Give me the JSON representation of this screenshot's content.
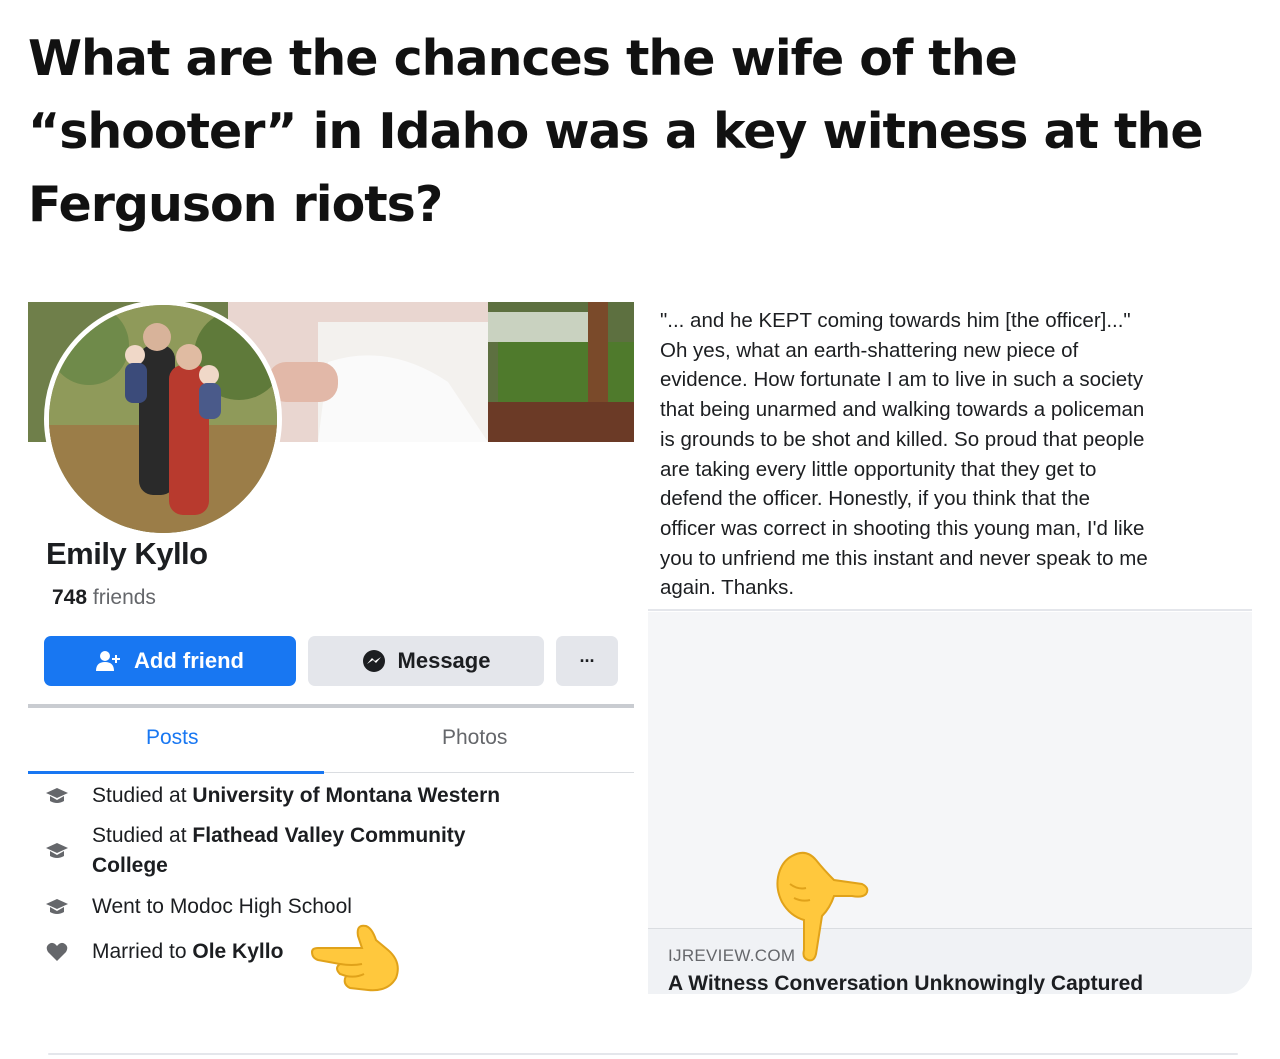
{
  "headline": "What are the chances the wife of the “shooter” in Idaho was a key witness at the Ferguson riots?",
  "profile": {
    "name": "Emily Kyllo",
    "friends_count": "748",
    "friends_label": "friends",
    "add_friend_label": "Add friend",
    "message_label": "Message",
    "more_label": "···",
    "tabs": [
      {
        "label": "Posts",
        "active": true
      },
      {
        "label": "Photos",
        "active": false
      }
    ],
    "intro": [
      {
        "icon": "graduation-cap-icon",
        "prefix": "Studied at ",
        "bold": "University of Montana Western"
      },
      {
        "icon": "graduation-cap-icon",
        "prefix": "Studied at ",
        "bold": "Flathead Valley Community",
        "bold2": "College"
      },
      {
        "icon": "graduation-cap-icon",
        "prefix": "Went to Modoc High School",
        "bold": ""
      },
      {
        "icon": "heart-icon",
        "prefix": "Married to ",
        "bold": "Ole Kyllo"
      }
    ]
  },
  "comment": {
    "lines": [
      "\"... and he KEPT coming towards him [the officer]...\"",
      "Oh yes, what an earth-shattering new piece of",
      "evidence. How fortunate I am to live in such a society",
      "that being unarmed and walking towards a policeman",
      "is grounds to be shot and killed. So proud that people",
      "are taking every little opportunity that they get to",
      "defend the officer. Honestly, if you think that the",
      "officer was correct in shooting this young man, I'd like",
      "you to unfriend me this instant and never speak to me",
      "again. Thanks."
    ]
  },
  "link_card": {
    "domain": "IJREVIEW.COM",
    "title": "A Witness Conversation Unknowingly Captured"
  },
  "colors": {
    "facebook_blue": "#1877f2",
    "button_gray": "#e4e6eb",
    "secondary_text": "#65676b"
  },
  "icons": [
    "person-add-icon",
    "messenger-icon",
    "more-options-icon",
    "graduation-cap-icon",
    "heart-icon",
    "pointing-hand-emoji"
  ]
}
